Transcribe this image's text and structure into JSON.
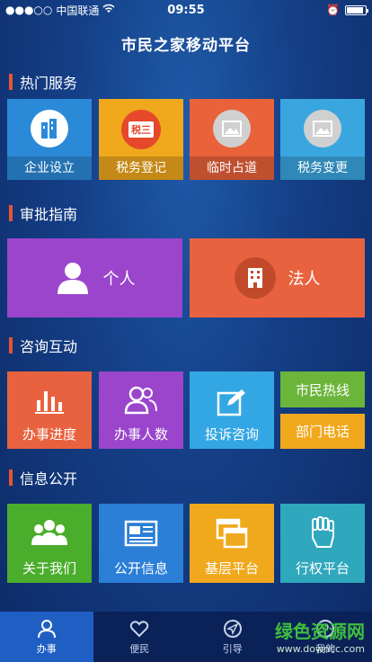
{
  "status": {
    "carrier": "中国联通",
    "time": "09:55"
  },
  "app_title": "市民之家移动平台",
  "sections": {
    "hot": "热门服务",
    "guide": "审批指南",
    "consult": "咨询互动",
    "info": "信息公开"
  },
  "hot_tiles": [
    {
      "label": "企业设立",
      "color": "#2b8ad8"
    },
    {
      "label": "税务登记",
      "color": "#f0a81c",
      "badge": "税三"
    },
    {
      "label": "临时占道",
      "color": "#e9623a"
    },
    {
      "label": "税务变更",
      "color": "#3aa6e0"
    }
  ],
  "guide_tiles": [
    {
      "label": "个人",
      "color": "#9a45cc"
    },
    {
      "label": "法人",
      "color": "#e8623f"
    }
  ],
  "consult_tiles": {
    "progress": "办事进度",
    "people": "办事人数",
    "complaint": "投诉咨询",
    "hotline": "市民热线",
    "dept_phone": "部门电话"
  },
  "info_tiles": {
    "about": "关于我们",
    "public_info": "公开信息",
    "grassroots": "基层平台",
    "power": "行权平台"
  },
  "tabs": [
    "办事",
    "便民",
    "引导",
    "我的"
  ],
  "watermark": {
    "title": "绿色资源网",
    "url": "www.downcc.com"
  }
}
